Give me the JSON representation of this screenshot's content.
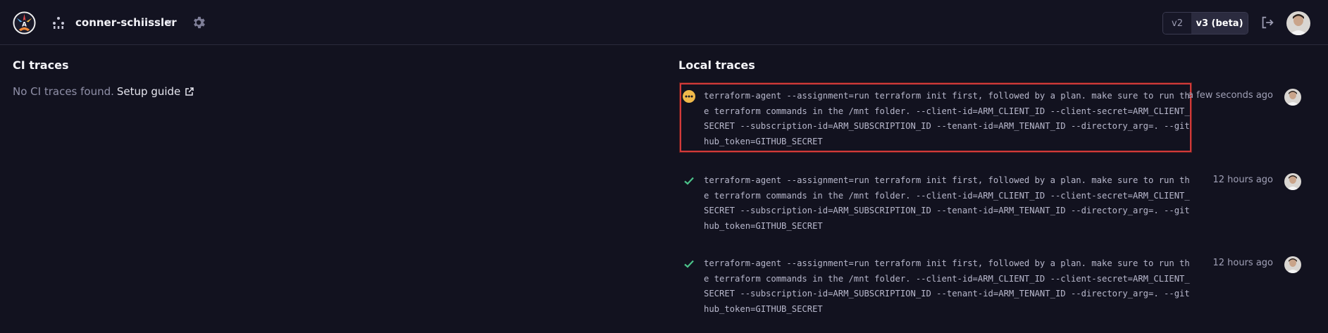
{
  "header": {
    "org_name": "conner-schiissler",
    "version_v2": "v2",
    "version_v3": "v3 (beta)"
  },
  "ci": {
    "title": "CI traces",
    "empty_text": "No CI traces found.",
    "guide_label": "Setup guide"
  },
  "local": {
    "title": "Local traces",
    "traces": [
      {
        "status": "running",
        "command": "terraform-agent --assignment=run terraform init first, followed by a plan. make sure to run the terraform commands in the /mnt folder. --client-id=ARM_CLIENT_ID --client-secret=ARM_CLIENT_SECRET --subscription-id=ARM_SUBSCRIPTION_ID --tenant-id=ARM_TENANT_ID --directory_arg=. --github_token=GITHUB_SECRET",
        "time": "a few seconds ago"
      },
      {
        "status": "success",
        "command": "terraform-agent --assignment=run terraform init first, followed by a plan. make sure to run the terraform commands in the /mnt folder. --client-id=ARM_CLIENT_ID --client-secret=ARM_CLIENT_SECRET --subscription-id=ARM_SUBSCRIPTION_ID --tenant-id=ARM_TENANT_ID --directory_arg=. --github_token=GITHUB_SECRET",
        "time": "12 hours ago"
      },
      {
        "status": "success",
        "command": "terraform-agent --assignment=run terraform init first, followed by a plan. make sure to run the terraform commands in the /mnt folder. --client-id=ARM_CLIENT_ID --client-secret=ARM_CLIENT_SECRET --subscription-id=ARM_SUBSCRIPTION_ID --tenant-id=ARM_TENANT_ID --directory_arg=. --github_token=GITHUB_SECRET",
        "time": "12 hours ago"
      }
    ]
  },
  "colors": {
    "background": "#12121f",
    "highlight_border": "#d23a3a",
    "running": "#f0b94a",
    "success": "#4cc38a"
  },
  "icons": [
    "logo",
    "org-icon",
    "chevron-down-icon",
    "gear-icon",
    "logout-icon",
    "external-link-icon",
    "running-icon",
    "check-icon",
    "avatar"
  ]
}
